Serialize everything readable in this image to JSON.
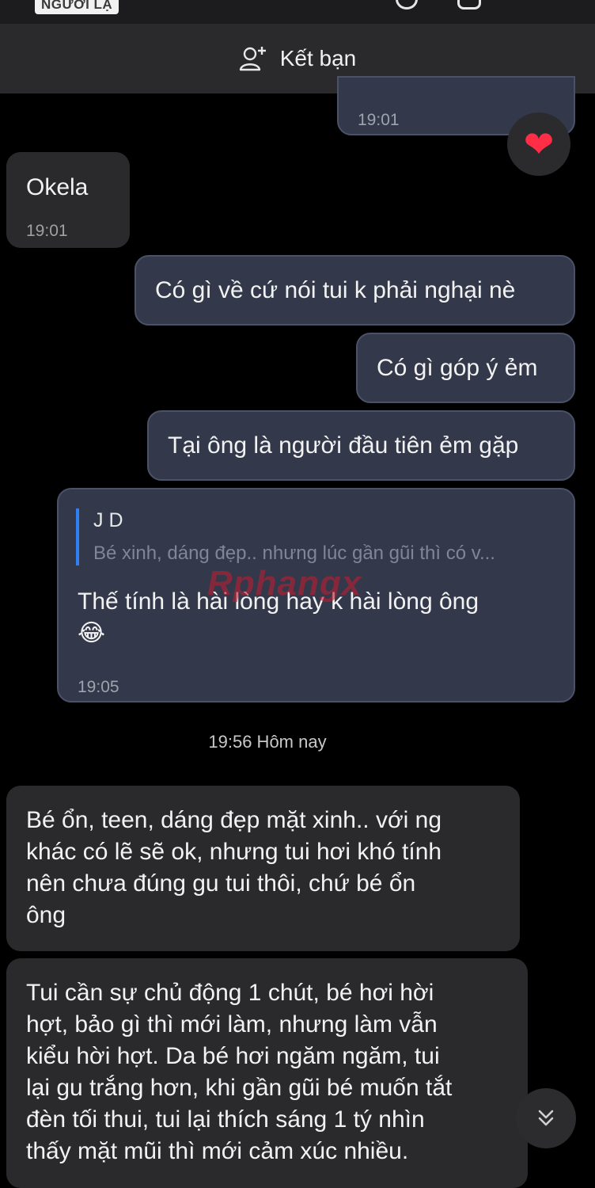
{
  "header": {
    "stranger_badge": "NGƯỜI LẠ",
    "add_friend_label": "Kết bạn"
  },
  "messages": [
    {
      "direction": "out",
      "time": "19:01",
      "reaction": "heart"
    },
    {
      "direction": "in",
      "text": "Okela",
      "time": "19:01"
    },
    {
      "direction": "out",
      "text": "Có gì về cứ nói tui k phải nghại nè"
    },
    {
      "direction": "out",
      "text": "Có gì góp ý ẻm"
    },
    {
      "direction": "out",
      "text": "Tại ông là người đầu tiên ẻm gặp"
    },
    {
      "direction": "out",
      "quote": {
        "name": "J D",
        "text": "Bé xinh, dáng đẹp.. nhưng lúc gần gũi thì có v..."
      },
      "text": "Thế tính là hài lòng hay k hài lòng ông",
      "emoji": "😂",
      "time": "19:05"
    },
    {
      "direction": "in",
      "text_lines": [
        "Bé ổn, teen, dáng đẹp mặt xinh.. với ng",
        "khác có lẽ sẽ ok, nhưng tui hơi khó tính",
        "nên chưa đúng gu tui thôi, chứ bé ổn",
        "ông"
      ]
    },
    {
      "direction": "in",
      "text_lines": [
        "Tui cần sự chủ động 1 chút, bé hơi hời",
        "hợt, bảo gì thì mới làm, nhưng làm vẫn",
        "kiểu hời hợt. Da bé hơi ngăm ngăm, tui",
        "lại gu trắng hơn, khi gần gũi bé muốn tắt",
        "đèn tối thui, tui lại thích sáng 1 tý nhìn",
        "thấy mặt mũi thì mới cảm xúc nhiều."
      ]
    }
  ],
  "date_separator": "19:56 Hôm nay",
  "watermark": "Rphangx",
  "icons": {
    "add_friend": "person-plus-icon",
    "reaction": "heart-icon",
    "scroll_down": "double-chevron-down-icon"
  },
  "colors": {
    "outgoing_bubble": "#33394a",
    "incoming_bubble": "#2a2a2c",
    "quote_accent": "#2f7ff5",
    "heart": "#ff2d45"
  }
}
